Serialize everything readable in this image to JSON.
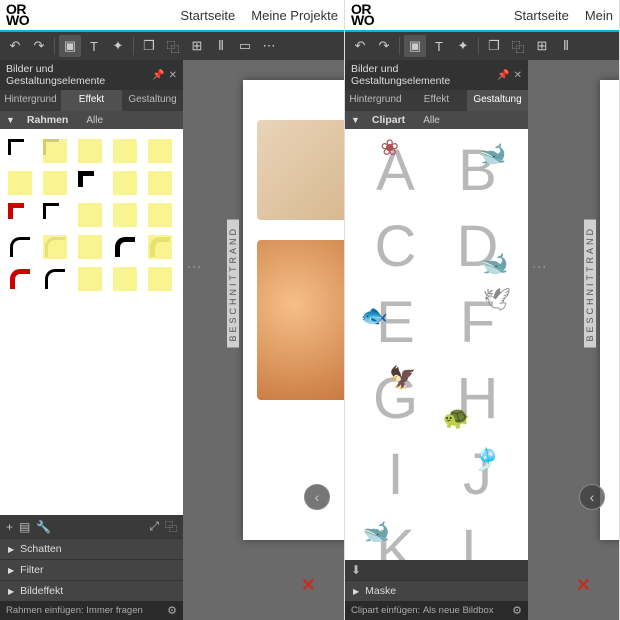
{
  "left": {
    "logo1": "OR",
    "logo2": "WO",
    "nav": {
      "home": "Startseite",
      "projects": "Meine Projekte"
    },
    "panel_title": "Bilder und Gestaltungselemente",
    "tabs": {
      "bg": "Hintergrund",
      "effect": "Effekt",
      "design": "Gestaltung"
    },
    "sub": {
      "section": "Rahmen",
      "all": "Alle"
    },
    "accordion": {
      "shadow": "Schatten",
      "filter": "Filter",
      "imgeffect": "Bildeffekt"
    },
    "footer_label": "Rahmen einfügen:",
    "footer_value": "Immer fragen",
    "beschnitt": "BESCHNITTRAND"
  },
  "right": {
    "logo1": "OR",
    "logo2": "WO",
    "nav": {
      "home": "Startseite",
      "projects": "Mein"
    },
    "panel_title": "Bilder und Gestaltungselemente",
    "tabs": {
      "bg": "Hintergrund",
      "effect": "Effekt",
      "design": "Gestaltung"
    },
    "sub": {
      "section": "Clipart",
      "all": "Alle"
    },
    "letters": [
      "A",
      "B",
      "C",
      "D",
      "E",
      "F",
      "G",
      "H",
      "I",
      "J",
      "K",
      "L"
    ],
    "accordion": {
      "mask": "Maske"
    },
    "footer_label": "Clipart einfügen:",
    "footer_value": "Als neue Bildbox",
    "beschnitt": "BESCHNITTRAND"
  }
}
